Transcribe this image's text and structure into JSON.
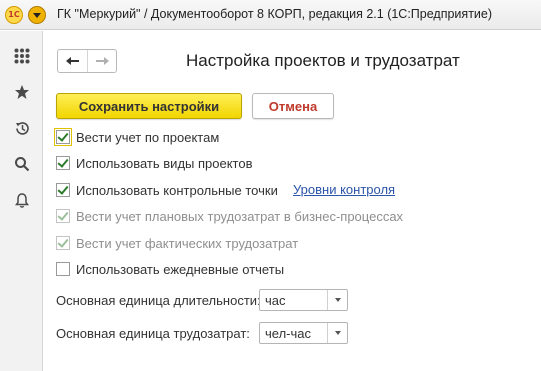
{
  "window": {
    "title": "ГК \"Меркурий\" / Документооборот 8 КОРП, редакция 2.1  (1С:Предприятие)",
    "logo_text": "1С"
  },
  "sidebar": {
    "icons": [
      "apps-grid-icon",
      "star-icon",
      "history-icon",
      "search-icon",
      "bell-icon"
    ]
  },
  "header": {
    "title": "Настройка проектов и трудозатрат",
    "back_icon": "arrow-left-icon",
    "forward_icon": "arrow-right-icon"
  },
  "actions": {
    "save_label": "Сохранить настройки",
    "cancel_label": "Отмена"
  },
  "options": [
    {
      "label": "Вести учет по проектам",
      "checked": true,
      "disabled": false
    },
    {
      "label": "Использовать виды проектов",
      "checked": true,
      "disabled": false
    },
    {
      "label": "Использовать контрольные точки",
      "checked": true,
      "disabled": false
    },
    {
      "label": "Вести учет плановых трудозатрат в бизнес-процессах",
      "checked": true,
      "disabled": true
    },
    {
      "label": "Вести учет фактических трудозатрат",
      "checked": true,
      "disabled": true
    },
    {
      "label": "Использовать ежедневные отчеты",
      "checked": false,
      "disabled": false
    }
  ],
  "links": {
    "control_levels": "Уровни контроля"
  },
  "fields": {
    "duration_unit": {
      "label": "Основная единица длительности:",
      "value": "час"
    },
    "labor_unit": {
      "label": "Основная единица трудозатрат:",
      "value": "чел-час"
    }
  },
  "colors": {
    "save_button": "#f2d500",
    "cancel_text": "#c0392b",
    "check": "#2c7a2c",
    "link": "#2a55a8"
  }
}
